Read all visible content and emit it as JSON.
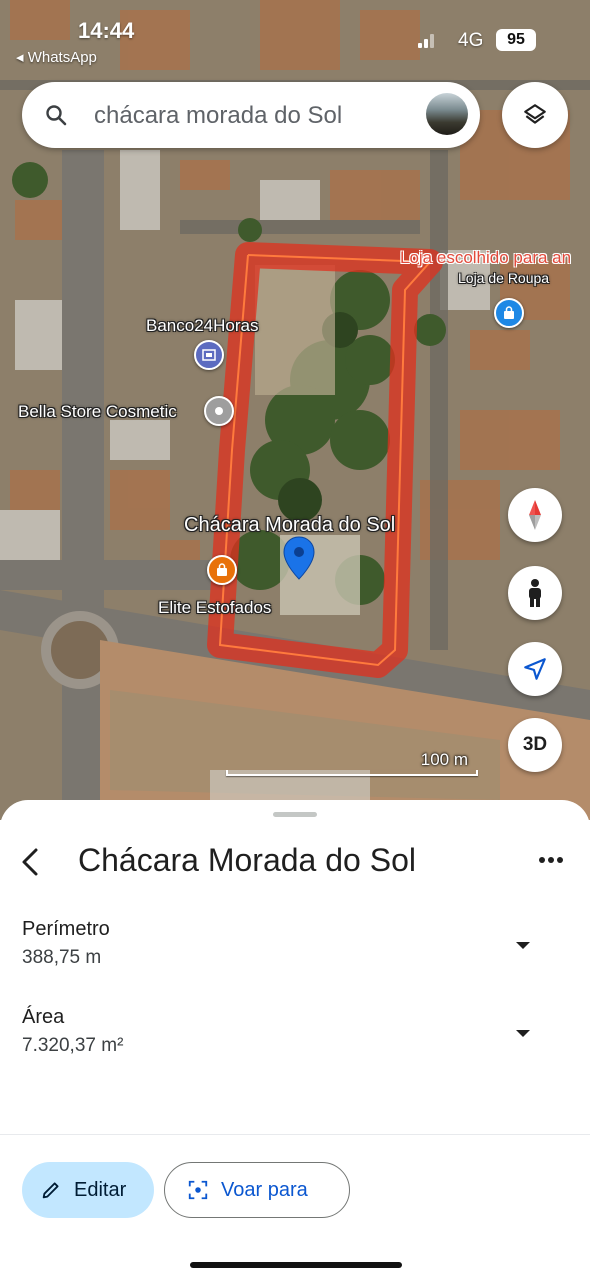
{
  "status_bar": {
    "time": "14:44",
    "back_app": "◂ WhatsApp",
    "network": "4G",
    "battery": "95"
  },
  "search": {
    "placeholder": "chácara morada do Sol"
  },
  "map": {
    "labels": {
      "loja_escolhido": "Loja escolhido para an",
      "loja_de_roupa": "Loja de Roupa",
      "banco24horas": "Banco24Horas",
      "bella_store": "Bella Store Cosmetic",
      "chacara": "Chácara Morada do Sol",
      "elite": "Elite Estofados"
    },
    "scale_label": "100 m",
    "btn_3d": "3D",
    "colors": {
      "pin": "#1a73e8",
      "outline": "#e0301e",
      "poi_bank": "#5c6bc0",
      "poi_shop": "#1e88e5",
      "poi_elite": "#e8710a"
    }
  },
  "sheet": {
    "title": "Chácara Morada do Sol",
    "metrics": [
      {
        "label": "Perímetro",
        "value": "388,75 m"
      },
      {
        "label": "Área",
        "value": "7.320,37 m²"
      }
    ],
    "buttons": {
      "edit": "Editar",
      "fly": "Voar para"
    }
  }
}
